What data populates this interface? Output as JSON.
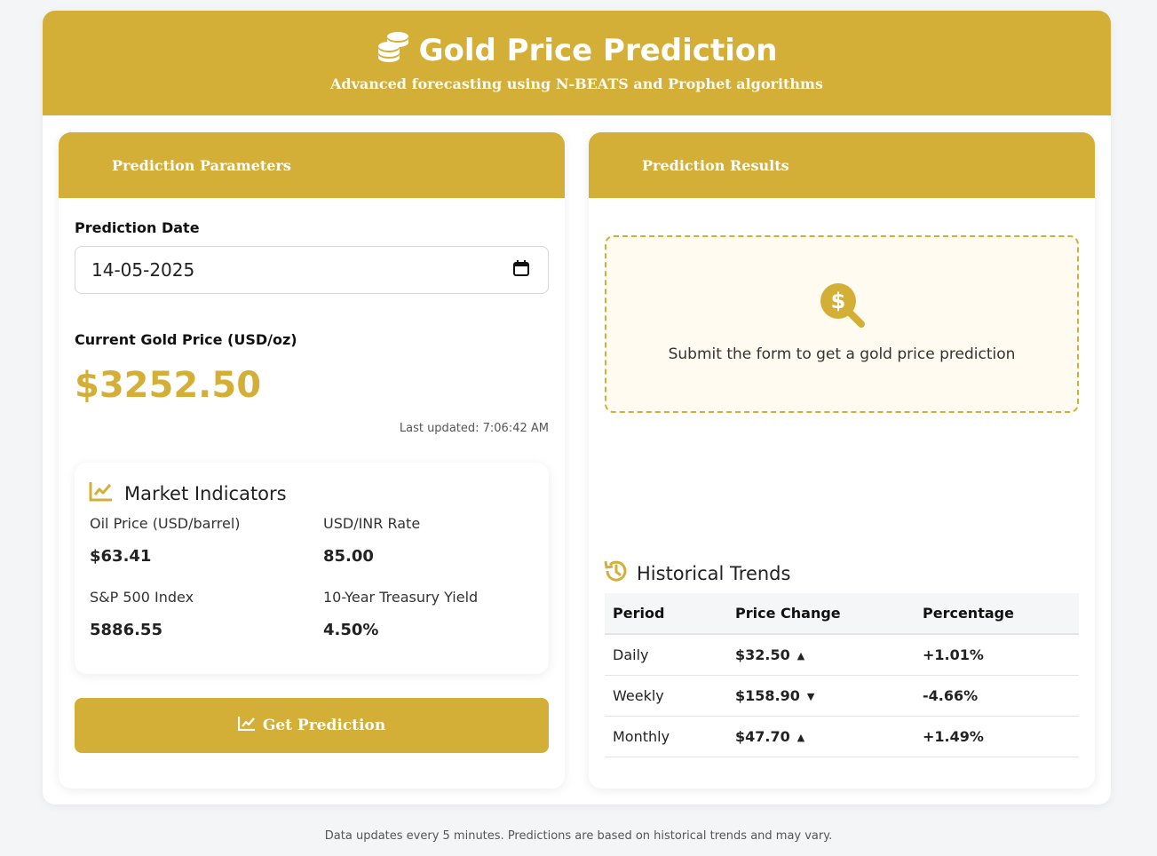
{
  "header": {
    "title": "Gold Price Prediction",
    "subtitle": "Advanced forecasting using N-BEATS and Prophet algorithms"
  },
  "params": {
    "card_title": "Prediction Parameters",
    "date_label": "Prediction Date",
    "date_value": "14-05-2025",
    "current_price_label": "Current Gold Price (USD/oz)",
    "current_price": "$3252.50",
    "last_updated": "Last updated: 7:06:42 AM",
    "market": {
      "title": "Market Indicators",
      "items": [
        {
          "label": "Oil Price (USD/barrel)",
          "value": "$63.41"
        },
        {
          "label": "USD/INR Rate",
          "value": "85.00"
        },
        {
          "label": "S&P 500 Index",
          "value": "5886.55"
        },
        {
          "label": "10-Year Treasury Yield",
          "value": "4.50%"
        }
      ]
    },
    "button_label": "Get Prediction"
  },
  "results": {
    "card_title": "Prediction Results",
    "placeholder_text": "Submit the form to get a gold price prediction",
    "history": {
      "title": "Historical Trends",
      "columns": [
        "Period",
        "Price Change",
        "Percentage"
      ],
      "rows": [
        {
          "period": "Daily",
          "change": "$32.50",
          "direction": "up",
          "pct": "+1.01%"
        },
        {
          "period": "Weekly",
          "change": "$158.90",
          "direction": "down",
          "pct": "-4.66%"
        },
        {
          "period": "Monthly",
          "change": "$47.70",
          "direction": "up",
          "pct": "+1.49%"
        }
      ]
    }
  },
  "footer": "Data updates every 5 minutes. Predictions are based on historical trends and may vary.",
  "colors": {
    "accent": "#d4af37"
  }
}
